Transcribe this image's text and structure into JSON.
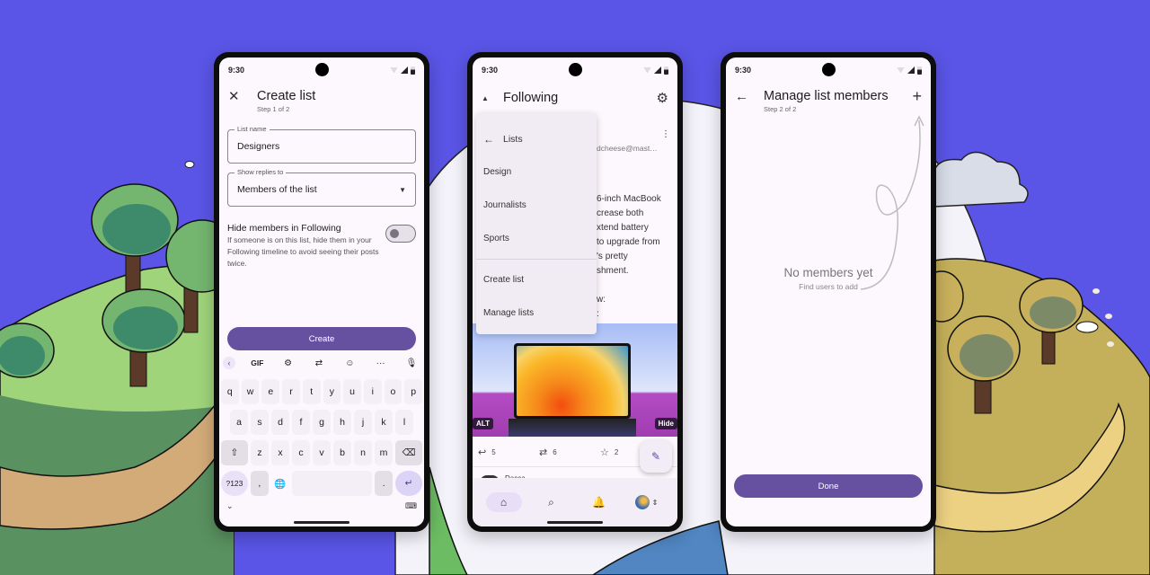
{
  "colors": {
    "background": "#5a55e6",
    "primary": "#65519f",
    "surface": "#fdf8fd",
    "menu_surface": "#f1ecf4"
  },
  "phones": [
    {
      "status": {
        "time": "9:30",
        "icons": [
          "wifi-icon",
          "signal-icon",
          "battery-icon"
        ]
      },
      "appbar": {
        "nav_icon": "close-icon",
        "title": "Create list",
        "subtitle": "Step 1 of 2"
      },
      "fields": [
        {
          "label": "List name",
          "value": "Designers"
        },
        {
          "label": "Show replies to",
          "value": "Members of the list",
          "icon": "dropdown-arrow-icon"
        }
      ],
      "toggle": {
        "title": "Hide members in Following",
        "description": "If someone is on this list, hide them in your Following timeline to avoid seeing their posts twice.",
        "on": false
      },
      "primary_button": "Create",
      "keyboard": {
        "toolbar": [
          "back-icon",
          "GIF",
          "settings-icon",
          "translate-icon",
          "sticker-icon",
          "more-icon",
          "mic-icon"
        ],
        "toolbar_labels": {
          "gif": "GIF",
          "more": "···"
        },
        "row1": [
          "q",
          "w",
          "e",
          "r",
          "t",
          "y",
          "u",
          "i",
          "o",
          "p"
        ],
        "row2": [
          "a",
          "s",
          "d",
          "f",
          "g",
          "h",
          "j",
          "k",
          "l"
        ],
        "row3": [
          "z",
          "x",
          "c",
          "v",
          "b",
          "n",
          "m"
        ],
        "symbols_key": "?123",
        "comma_key": ",",
        "period_key": "."
      }
    },
    {
      "status": {
        "time": "9:30"
      },
      "appbar": {
        "title": "Following",
        "action_icon": "gear-icon"
      },
      "menu": {
        "header": "Lists",
        "lists": [
          "Design",
          "Journalists",
          "Sports"
        ],
        "actions": [
          "Create list",
          "Manage lists"
        ]
      },
      "post": {
        "handle_fragment": "dcheese@mast…",
        "body_fragment": "6-inch MacBook\ncrease both\nxtend battery\nto upgrade from\n's pretty\nshment.\n\nw:\n:",
        "media_badges": {
          "alt": "ALT",
          "hide": "Hide"
        },
        "counts": {
          "replies": "5",
          "boosts": "6",
          "favourites": "2"
        }
      },
      "next_post_name": "Dacca",
      "bottom_nav": [
        "home-icon",
        "search-icon",
        "notifications-icon",
        "account-avatar"
      ]
    },
    {
      "status": {
        "time": "9:30"
      },
      "appbar": {
        "nav_icon": "back-arrow-icon",
        "title": "Manage list members",
        "subtitle": "Step 2 of 2",
        "action_icon": "add-icon"
      },
      "empty_state": {
        "title": "No members yet",
        "subtitle": "Find users to add"
      },
      "primary_button": "Done"
    }
  ]
}
